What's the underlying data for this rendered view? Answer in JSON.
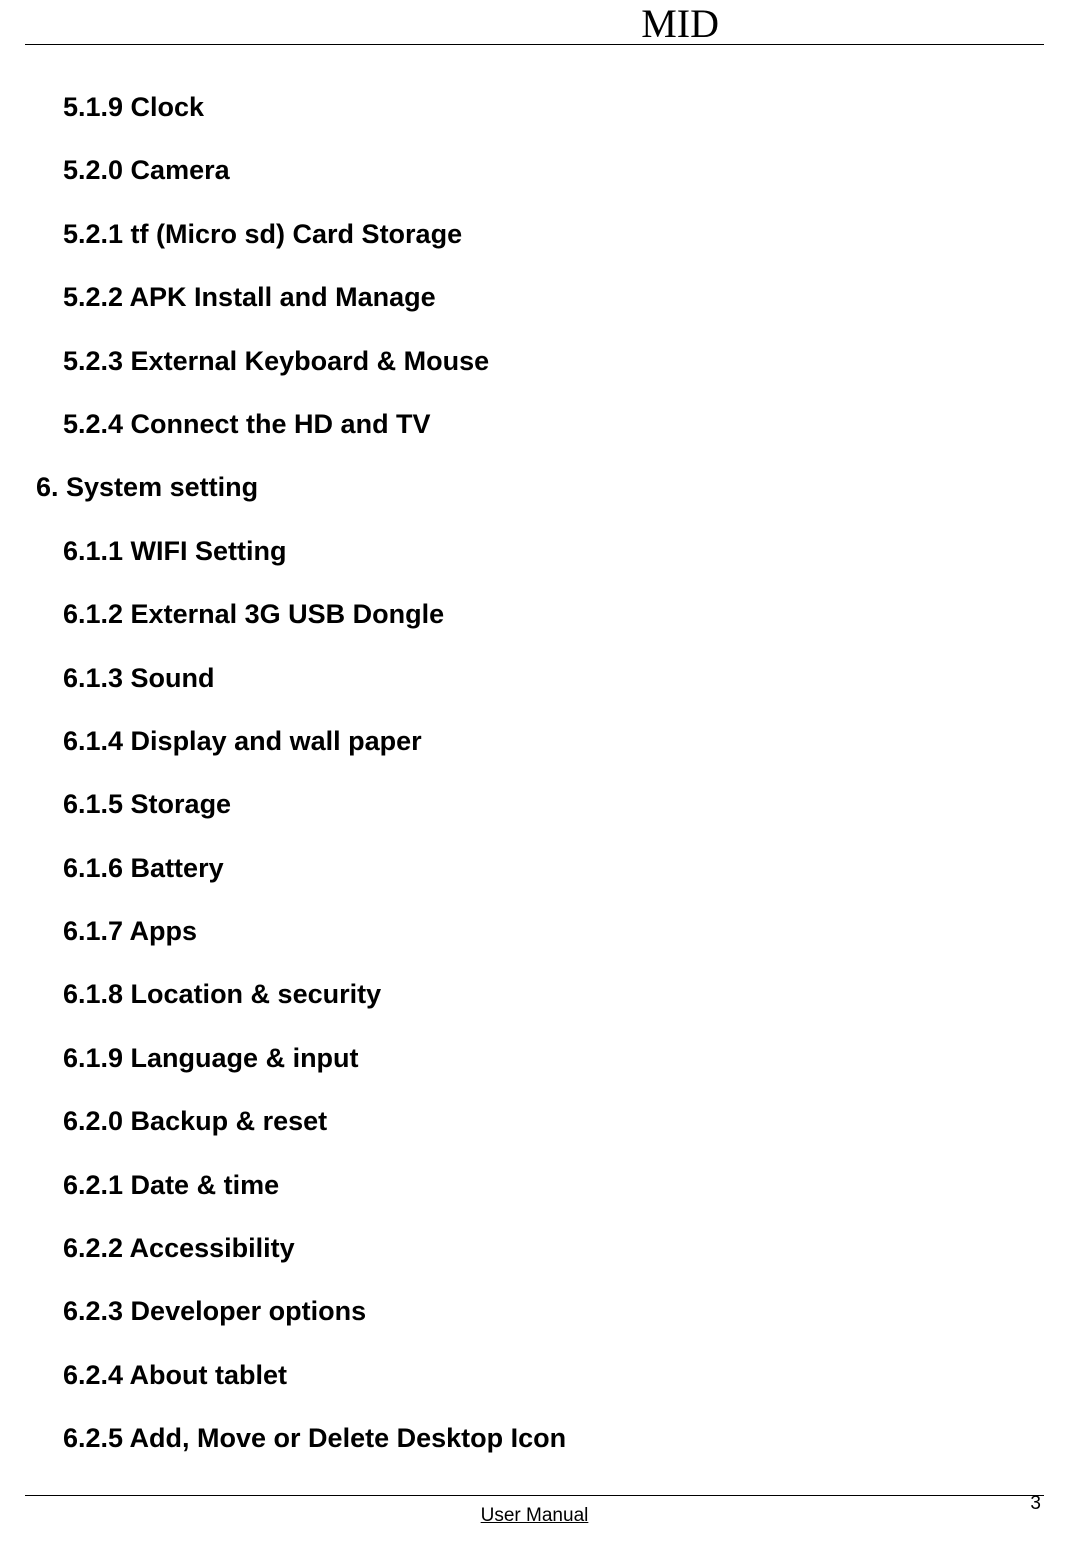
{
  "header": {
    "title": "MID"
  },
  "toc": {
    "entries": [
      {
        "text": "5.1.9 Clock",
        "indent": true
      },
      {
        "text": "5.2.0 Camera",
        "indent": true
      },
      {
        "text": "5.2.1 tf (Micro sd) Card Storage",
        "indent": true
      },
      {
        "text": "5.2.2 APK Install and Manage",
        "indent": true
      },
      {
        "text": "5.2.3 External Keyboard & Mouse",
        "indent": true
      },
      {
        "text": "5.2.4 Connect the HD and TV",
        "indent": true
      },
      {
        "text": "6. System setting",
        "indent": false
      },
      {
        "text": "6.1.1 WIFI Setting",
        "indent": true
      },
      {
        "text": "6.1.2 External 3G USB Dongle",
        "indent": true
      },
      {
        "text": "6.1.3 Sound",
        "indent": true
      },
      {
        "text": "6.1.4 Display and wall paper",
        "indent": true
      },
      {
        "text": "6.1.5 Storage",
        "indent": true
      },
      {
        "text": "6.1.6 Battery",
        "indent": true
      },
      {
        "text": "6.1.7 Apps",
        "indent": true
      },
      {
        "text": "6.1.8 Location & security",
        "indent": true
      },
      {
        "text": "6.1.9 Language & input",
        "indent": true
      },
      {
        "text": "6.2.0 Backup & reset",
        "indent": true
      },
      {
        "text": "6.2.1 Date & time",
        "indent": true
      },
      {
        "text": "6.2.2 Accessibility",
        "indent": true
      },
      {
        "text": "6.2.3 Developer options",
        "indent": true
      },
      {
        "text": "6.2.4 About tablet",
        "indent": true
      },
      {
        "text": "6.2.5 Add, Move or Delete Desktop Icon",
        "indent": true
      }
    ]
  },
  "footer": {
    "label": "User Manual",
    "page": "3"
  }
}
